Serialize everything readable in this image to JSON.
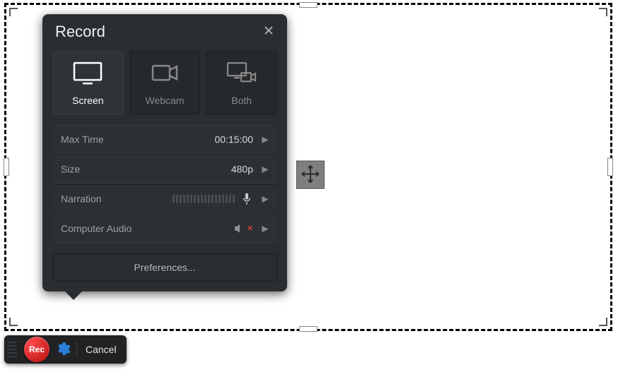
{
  "panel": {
    "title": "Record",
    "modes": [
      {
        "label": "Screen",
        "active": true
      },
      {
        "label": "Webcam",
        "active": false
      },
      {
        "label": "Both",
        "active": false
      }
    ],
    "options": {
      "max_time": {
        "label": "Max Time",
        "value": "00:15:00"
      },
      "size": {
        "label": "Size",
        "value": "480p"
      },
      "narration": {
        "label": "Narration"
      },
      "computer_audio": {
        "label": "Computer Audio",
        "muted": true
      }
    },
    "preferences_label": "Preferences..."
  },
  "toolbar": {
    "rec_label": "Rec",
    "cancel_label": "Cancel"
  }
}
